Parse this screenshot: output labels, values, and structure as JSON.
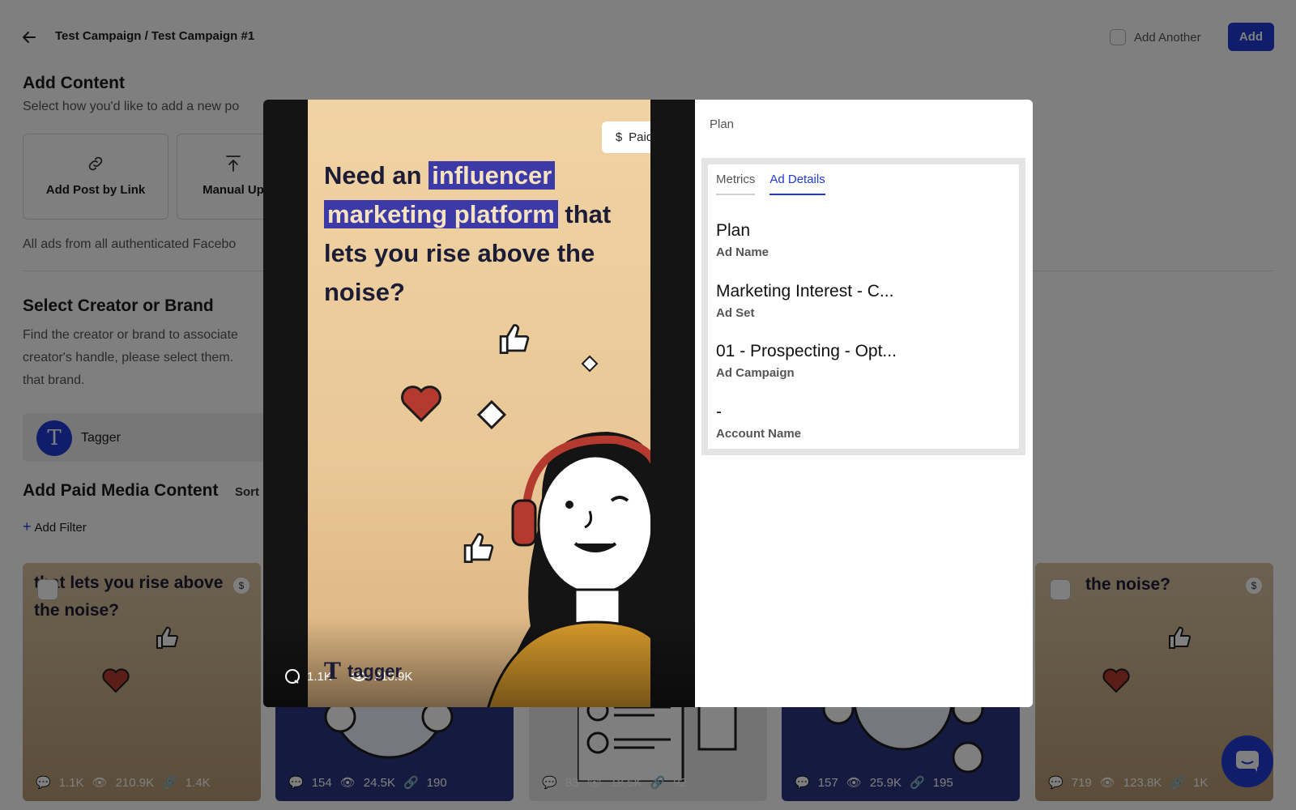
{
  "header": {
    "breadcrumb": "Test Campaign / Test Campaign #1",
    "add_another_label": "Add Another",
    "add_label": "Add"
  },
  "add_content": {
    "title": "Add Content",
    "subtitle": "Select how you'd like to add a new po",
    "methods": [
      {
        "label": "Add Post by Link",
        "icon": "link-icon"
      },
      {
        "label": "Manual Up",
        "icon": "upload-icon"
      }
    ],
    "ads_note": "All ads from all authenticated Facebo"
  },
  "creator": {
    "title": "Select Creator or Brand",
    "description_lines": [
      "Find the creator or brand to associate",
      "creator's handle, please select them.",
      "that brand."
    ],
    "selected_name": "Tagger",
    "avatar_letter": "T"
  },
  "paid_media": {
    "title": "Add Paid Media Content",
    "sort_label": "Sort",
    "add_filter_label": "Add Filter",
    "cards": [
      {
        "text": "that lets you rise above the noise?",
        "comments": "1.1K",
        "views": "210.9K",
        "engagements": "1.4K",
        "style": "tan"
      },
      {
        "text": "",
        "comments": "154",
        "views": "24.5K",
        "engagements": "190",
        "style": "navy"
      },
      {
        "text": "",
        "comments": "83",
        "views": "18.5K",
        "engagements": "92",
        "style": "grey"
      },
      {
        "text": "",
        "comments": "157",
        "views": "25.9K",
        "engagements": "195",
        "style": "navy"
      },
      {
        "text": "the noise?",
        "comments": "719",
        "views": "123.8K",
        "engagements": "1K",
        "style": "tan"
      }
    ]
  },
  "modal": {
    "media": {
      "headline_plain_1": "Need an ",
      "headline_hl_1": "influencer",
      "headline_hl_2": "marketing platform",
      "headline_plain_2": " that lets you rise above the noise?",
      "paid_label": "Paid",
      "comments": "1.1K",
      "views": "210.9K",
      "brand_wordmark": "tagger"
    },
    "plan_header": "Plan",
    "tabs": [
      "Metrics",
      "Ad Details"
    ],
    "active_tab": "Ad Details",
    "fields": [
      {
        "value": "Plan",
        "label": "Ad Name"
      },
      {
        "value": "Marketing Interest - C...",
        "label": "Ad Set"
      },
      {
        "value": "01 - Prospecting - Opt...",
        "label": "Ad Campaign"
      },
      {
        "value": "-",
        "label": "Account Name"
      }
    ]
  },
  "colors": {
    "accent": "#1f3bd6",
    "highlight": "#3b3aa6",
    "media_background": "#efd2a3"
  }
}
